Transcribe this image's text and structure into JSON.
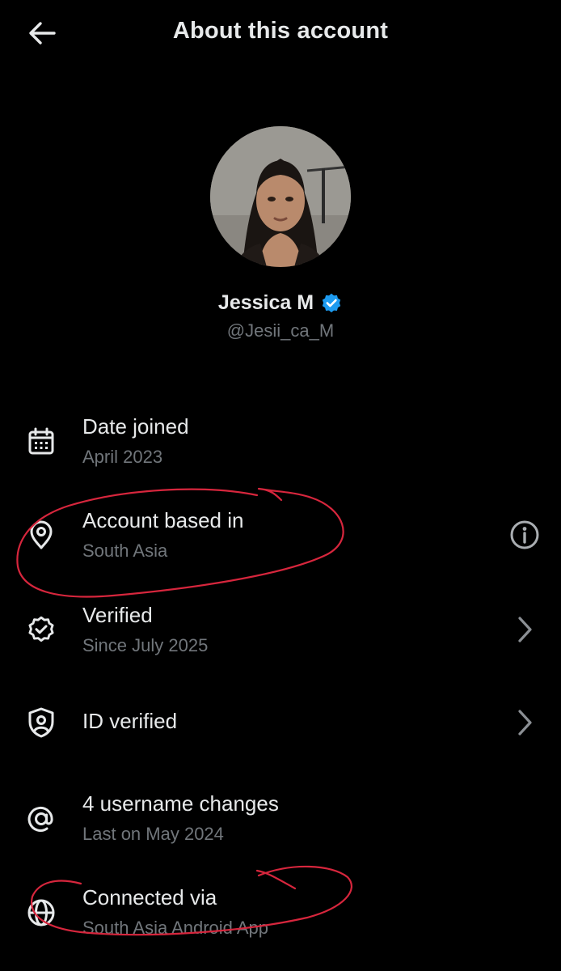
{
  "header": {
    "title": "About this account",
    "back_icon": "arrow-left-icon"
  },
  "profile": {
    "display_name": "Jessica M",
    "handle": "@Jesii_ca_M",
    "verified_badge_color": "#1d9bf0",
    "verified_icon": "verified-badge-icon"
  },
  "details": [
    {
      "icon": "calendar-icon",
      "title": "Date joined",
      "subtitle": "April 2023",
      "trailing": null
    },
    {
      "icon": "location-pin-icon",
      "title": "Account based in",
      "subtitle": "South Asia",
      "trailing": "info-icon"
    },
    {
      "icon": "verified-seal-icon",
      "title": "Verified",
      "subtitle": "Since July 2025",
      "trailing": "chevron-right-icon"
    },
    {
      "icon": "shield-person-icon",
      "title": "ID verified",
      "subtitle": "",
      "trailing": "chevron-right-icon"
    },
    {
      "icon": "at-sign-icon",
      "title": "4 username changes",
      "subtitle": "Last on May 2024",
      "trailing": null
    },
    {
      "icon": "globe-icon",
      "title": "Connected via",
      "subtitle": "South Asia Android App",
      "trailing": null
    }
  ],
  "colors": {
    "background": "#000000",
    "primary_text": "#e7e9ea",
    "secondary_text": "#71767b",
    "annotation_red": "#d7263d"
  }
}
